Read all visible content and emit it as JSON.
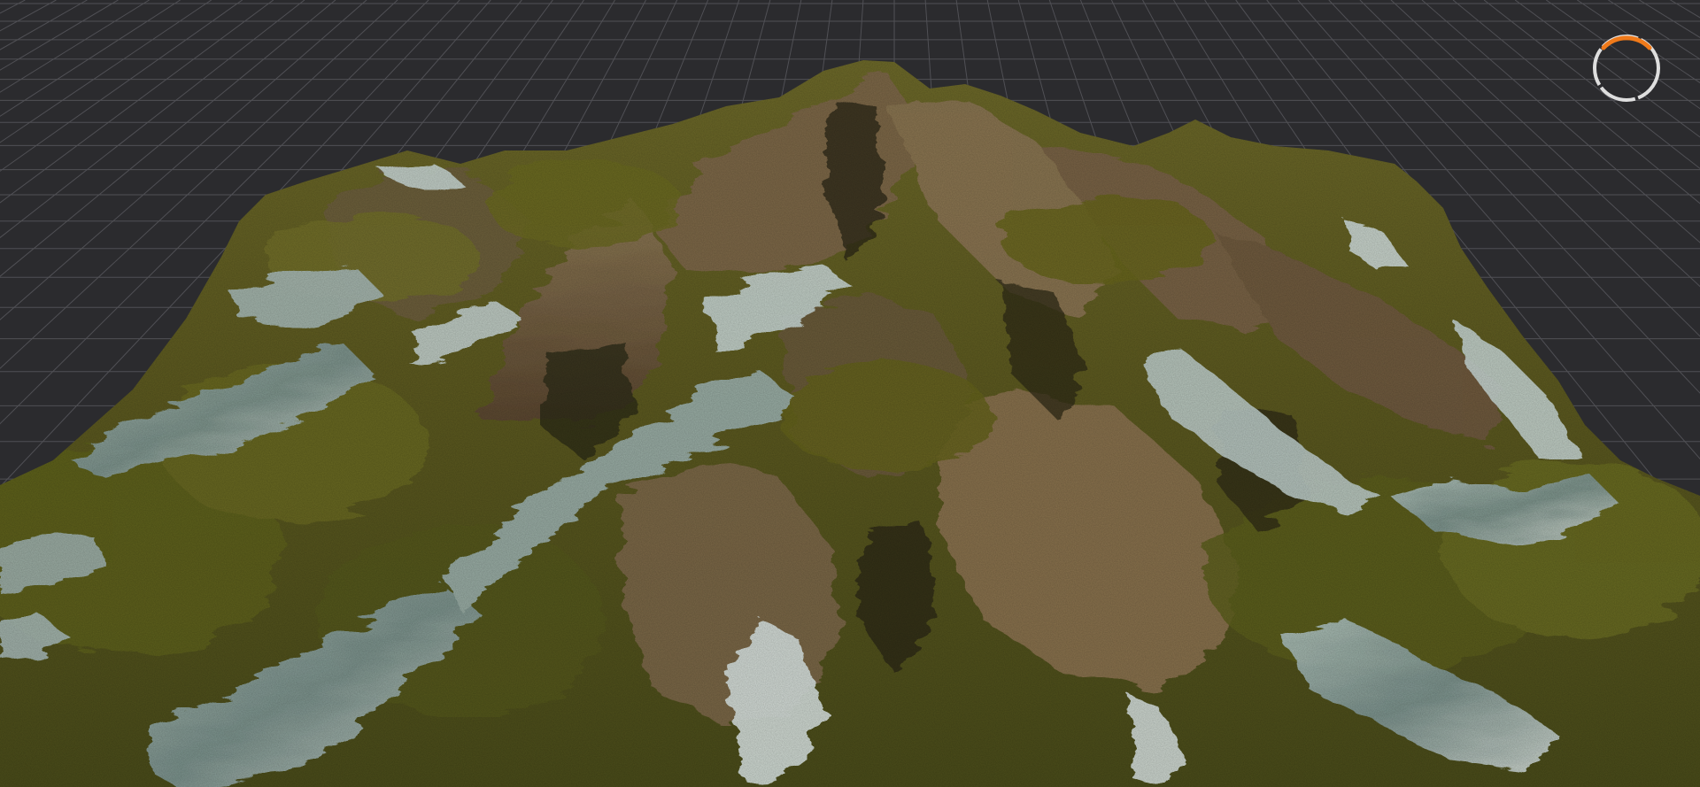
{
  "scene": {
    "background_color": "#2b2b2e",
    "grid_color": "#505055",
    "terrain_palette": {
      "grass": "#6b6a22",
      "moss": "#4f5419",
      "rock": "#7a6548",
      "rock_light": "#9a8262",
      "shadow": "#2a2614",
      "water": "#8ea6a4",
      "water_shadow": "#3d5252"
    }
  },
  "loading_indicator": {
    "icon": "loading-ring-icon",
    "ring_color": "#e8e8e8",
    "arc_color": "#f07a1a"
  }
}
